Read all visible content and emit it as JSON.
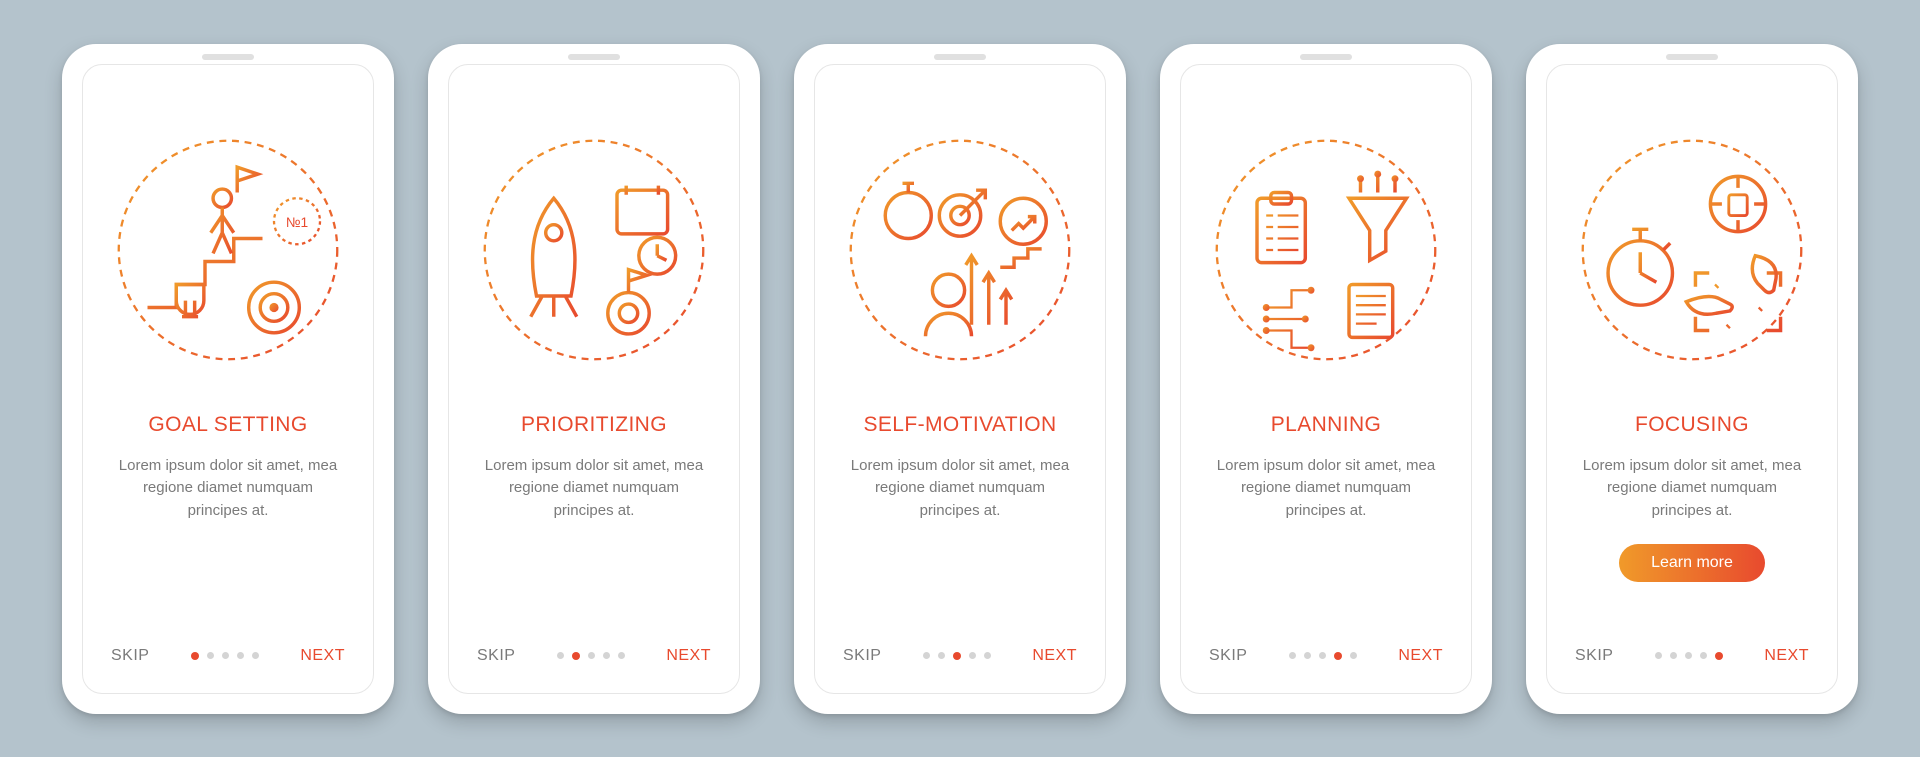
{
  "nav": {
    "skip": "SKIP",
    "next": "NEXT",
    "learn_more": "Learn more"
  },
  "desc": "Lorem ipsum dolor sit amet, mea regione diamet numquam principes at.",
  "screens": [
    {
      "title": "Goal setting",
      "icon": "goal-setting-illustration",
      "active_dot": 0,
      "has_cta": false
    },
    {
      "title": "Prioritizing",
      "icon": "prioritizing-illustration",
      "active_dot": 1,
      "has_cta": false
    },
    {
      "title": "Self-motivation",
      "icon": "self-motivation-illustration",
      "active_dot": 2,
      "has_cta": false
    },
    {
      "title": "Planning",
      "icon": "planning-illustration",
      "active_dot": 3,
      "has_cta": false
    },
    {
      "title": "Focusing",
      "icon": "focusing-illustration",
      "active_dot": 4,
      "has_cta": true
    }
  ],
  "colors": {
    "accent": "#e84a2e",
    "accent2": "#f09a2a",
    "text_muted": "#7a7a7a"
  }
}
